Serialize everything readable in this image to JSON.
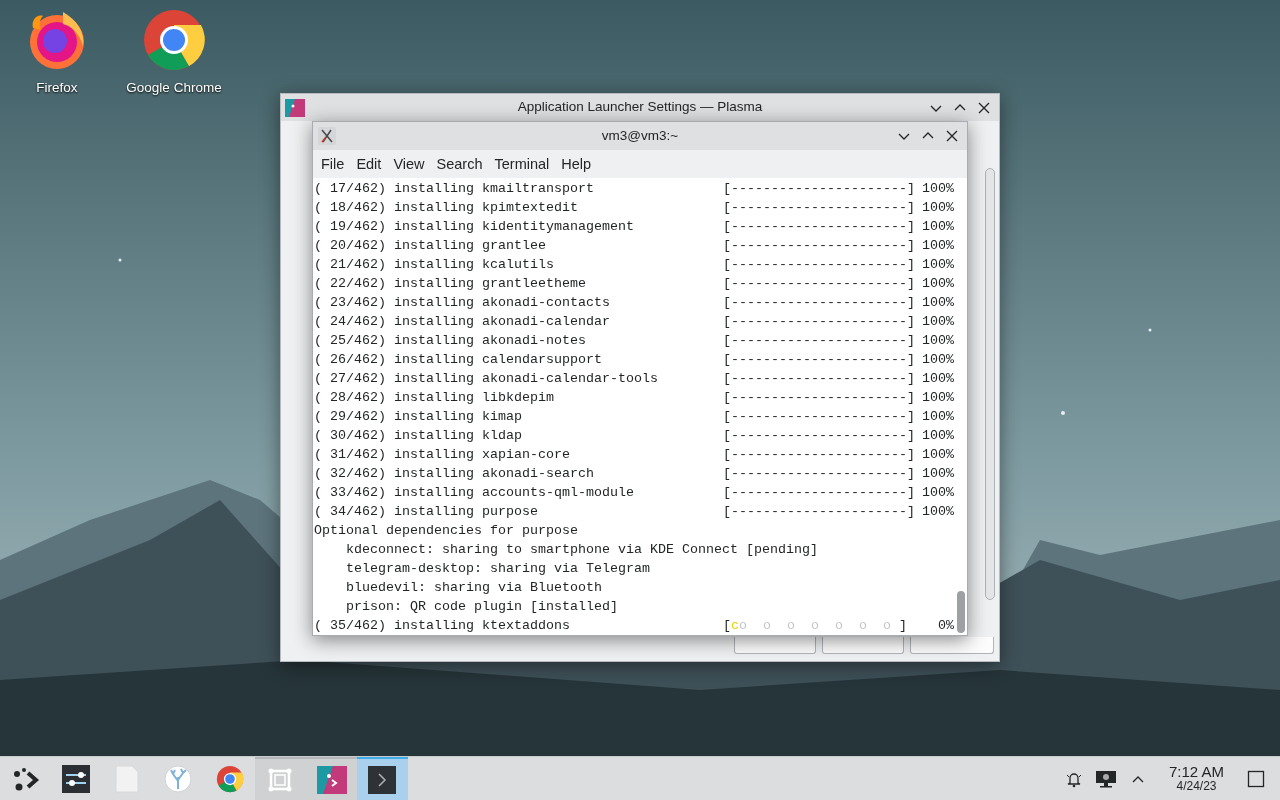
{
  "desktop_icons": [
    {
      "kind": "firefox",
      "label": "Firefox"
    },
    {
      "kind": "chrome",
      "label": "Google Chrome"
    }
  ],
  "back_window": {
    "title": "Application Launcher Settings — Plasma",
    "buttons": [
      {
        "kind": "ok"
      },
      {
        "kind": "apply"
      },
      {
        "kind": "cancel"
      }
    ]
  },
  "terminal": {
    "title": "vm3@vm3:~",
    "menu": [
      "File",
      "Edit",
      "View",
      "Search",
      "Terminal",
      "Help"
    ],
    "lines": [
      {
        "kind": "install",
        "text": "( 17/462) installing kmailtransport",
        "bar": "[----------------------]",
        "percent": "100%"
      },
      {
        "kind": "install",
        "text": "( 18/462) installing kpimtextedit",
        "bar": "[----------------------]",
        "percent": "100%"
      },
      {
        "kind": "install",
        "text": "( 19/462) installing kidentitymanagement",
        "bar": "[----------------------]",
        "percent": "100%"
      },
      {
        "kind": "install",
        "text": "( 20/462) installing grantlee",
        "bar": "[----------------------]",
        "percent": "100%"
      },
      {
        "kind": "install",
        "text": "( 21/462) installing kcalutils",
        "bar": "[----------------------]",
        "percent": "100%"
      },
      {
        "kind": "install",
        "text": "( 22/462) installing grantleetheme",
        "bar": "[----------------------]",
        "percent": "100%"
      },
      {
        "kind": "install",
        "text": "( 23/462) installing akonadi-contacts",
        "bar": "[----------------------]",
        "percent": "100%"
      },
      {
        "kind": "install",
        "text": "( 24/462) installing akonadi-calendar",
        "bar": "[----------------------]",
        "percent": "100%"
      },
      {
        "kind": "install",
        "text": "( 25/462) installing akonadi-notes",
        "bar": "[----------------------]",
        "percent": "100%"
      },
      {
        "kind": "install",
        "text": "( 26/462) installing calendarsupport",
        "bar": "[----------------------]",
        "percent": "100%"
      },
      {
        "kind": "install",
        "text": "( 27/462) installing akonadi-calendar-tools",
        "bar": "[----------------------]",
        "percent": "100%"
      },
      {
        "kind": "install",
        "text": "( 28/462) installing libkdepim",
        "bar": "[----------------------]",
        "percent": "100%"
      },
      {
        "kind": "install",
        "text": "( 29/462) installing kimap",
        "bar": "[----------------------]",
        "percent": "100%"
      },
      {
        "kind": "install",
        "text": "( 30/462) installing kldap",
        "bar": "[----------------------]",
        "percent": "100%"
      },
      {
        "kind": "install",
        "text": "( 31/462) installing xapian-core",
        "bar": "[----------------------]",
        "percent": "100%"
      },
      {
        "kind": "install",
        "text": "( 32/462) installing akonadi-search",
        "bar": "[----------------------]",
        "percent": "100%"
      },
      {
        "kind": "install",
        "text": "( 33/462) installing accounts-qml-module",
        "bar": "[----------------------]",
        "percent": "100%"
      },
      {
        "kind": "install",
        "text": "( 34/462) installing purpose",
        "bar": "[----------------------]",
        "percent": "100%"
      },
      {
        "kind": "heading",
        "text": "Optional dependencies for purpose",
        "children": [
          {
            "text": "kdeconnect: sharing to smartphone via KDE Connect [pending]"
          },
          {
            "text": "telegram-desktop: sharing via Telegram"
          },
          {
            "text": "bluedevil: sharing via Bluetooth"
          },
          {
            "text": "prison: QR code plugin [installed]"
          }
        ]
      },
      {
        "kind": "pacman",
        "text": "( 35/462) installing ktextaddons",
        "bar_start": "[",
        "eater": "c",
        "dots": "o  o  o  o  o  o  o",
        "bar_end": "]",
        "percent": "0%"
      }
    ]
  },
  "taskbar": {
    "items": [
      {
        "kind": "launcher",
        "open": false,
        "selected": false
      },
      {
        "kind": "settings",
        "open": false,
        "selected": false
      },
      {
        "kind": "file",
        "open": false,
        "selected": false
      },
      {
        "kind": "coral",
        "open": false,
        "selected": false
      },
      {
        "kind": "chrome",
        "open": false,
        "selected": false
      },
      {
        "kind": "frame",
        "open": true,
        "selected": false
      },
      {
        "kind": "plasma",
        "open": true,
        "selected": false
      },
      {
        "kind": "terminal",
        "open": true,
        "selected": true
      }
    ],
    "time": "7:12 AM",
    "date": "4/24/23"
  }
}
